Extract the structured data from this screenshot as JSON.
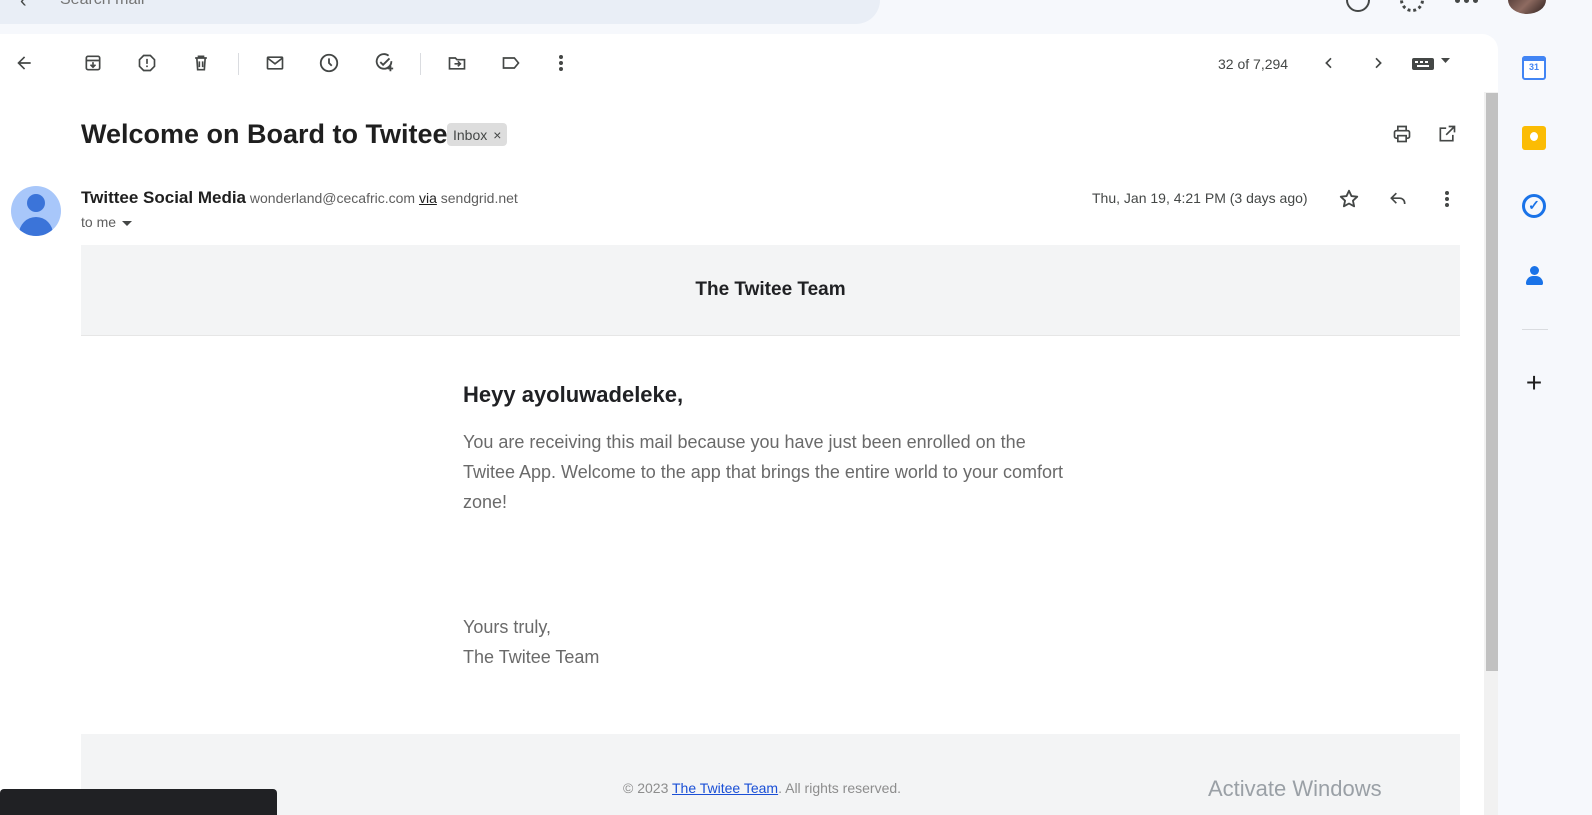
{
  "search": {
    "placeholder": "Search mail"
  },
  "toolbar": {
    "counter": "32 of 7,294",
    "icons": [
      "back-arrow-icon",
      "archive-icon",
      "report-spam-icon",
      "delete-icon",
      "mark-unread-icon",
      "snooze-icon",
      "add-to-tasks-icon",
      "move-to-icon",
      "label-icon",
      "more-vert-icon",
      "newer-icon",
      "older-icon",
      "keyboard-icon"
    ]
  },
  "email": {
    "subject": "Welcome on Board to Twitee!",
    "label": "Inbox",
    "label_close": "×",
    "sender_name": "Twittee Social Media",
    "sender_email": "wonderland@cecafric.com",
    "via": "via",
    "via_domain": "sendgrid.net",
    "recipient": "to me",
    "datetime": "Thu, Jan 19, 4:21 PM (3 days ago)"
  },
  "body": {
    "header": "The Twitee Team",
    "greeting": "Heyy ayoluwadeleke,",
    "paragraph": "You are receiving this mail because you have just been enrolled on the Twitee App. Welcome to the app that brings the entire world to your comfort zone!",
    "signoff_1": "Yours truly,",
    "signoff_2": "The Twitee Team",
    "footer_prefix": "© 2023",
    "footer_link": "The Twitee Team",
    "footer_suffix": ". All rights reserved."
  },
  "side_panel": {
    "calendar_day": "31",
    "add_label": "+"
  },
  "watermark": "Activate Windows",
  "colors": {
    "accent": "#1a73e8",
    "app_background": "#f6f8fc",
    "card": "#ffffff",
    "email_band": "#f3f4f5"
  }
}
